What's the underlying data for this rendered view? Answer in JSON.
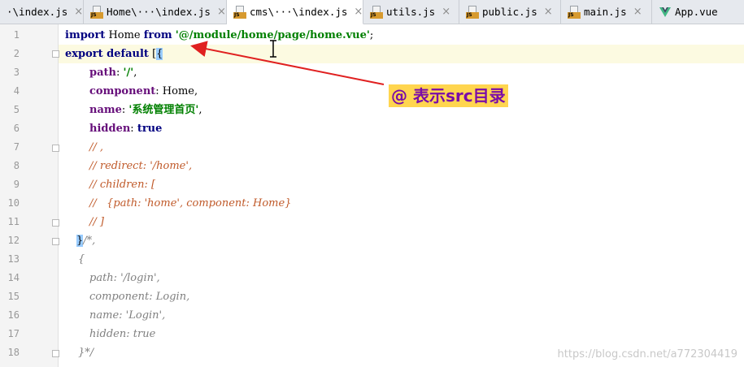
{
  "tabs": [
    {
      "label": "·\\index.js",
      "type": "js",
      "active": false
    },
    {
      "label": "Home\\···\\index.js",
      "type": "js",
      "active": false
    },
    {
      "label": "cms\\···\\index.js",
      "type": "js",
      "active": true
    },
    {
      "label": "utils.js",
      "type": "js",
      "active": false
    },
    {
      "label": "public.js",
      "type": "js",
      "active": false
    },
    {
      "label": "main.js",
      "type": "js",
      "active": false
    },
    {
      "label": "App.vue",
      "type": "vue",
      "active": false
    }
  ],
  "tab_close_glyph": "×",
  "icons": {
    "js_badge": "JS",
    "js_file": "js-file-icon",
    "vue_file": "vue-logo-icon"
  },
  "line_numbers": [
    "1",
    "2",
    "3",
    "4",
    "5",
    "6",
    "7",
    "8",
    "9",
    "10",
    "11",
    "12",
    "13",
    "14",
    "15",
    "16",
    "17",
    "18"
  ],
  "code": {
    "l1": {
      "kw1": "import",
      "t1": " Home ",
      "kw2": "from",
      "t2": " ",
      "str": "'@/module/home/page/home.vue'",
      "t3": ";"
    },
    "l2": {
      "kw": "export default",
      "t1": " [",
      "brace": "{"
    },
    "l3": {
      "prop": "path",
      "t1": ": ",
      "str": "'/'",
      "t2": ","
    },
    "l4": {
      "prop": "component",
      "t1": ": Home,"
    },
    "l5": {
      "prop": "name",
      "t1": ": ",
      "str": "'系统管理首页'",
      "t2": ","
    },
    "l6": {
      "prop": "hidden",
      "t1": ": ",
      "kw": "true"
    },
    "l7": {
      "cmt": "// ,"
    },
    "l8": {
      "cmt": "// redirect: '/home',"
    },
    "l9": {
      "cmt": "// children: ["
    },
    "l10": {
      "cmt": "//   {path: 'home', component: Home}"
    },
    "l11": {
      "cmt": "// ]"
    },
    "l12": {
      "brace": "}",
      "cmt": "/*,"
    },
    "l13": {
      "gcmt": "{"
    },
    "l14": {
      "gcmt": "path: '/login',"
    },
    "l15": {
      "gcmt": "component: Login,"
    },
    "l16": {
      "gcmt": "name: 'Login',"
    },
    "l17": {
      "gcmt": "hidden: true"
    },
    "l18": {
      "gcmt": "}*/"
    }
  },
  "annotation": "@ 表示src目录",
  "watermark": "https://blog.csdn.net/a772304419",
  "colors": {
    "annotation_bg": "#ffd54f",
    "annotation_text": "#7a0ca8",
    "arrow": "#e02020",
    "keyword": "#000080",
    "string": "#008000",
    "property": "#660e7a",
    "comment": "#c05a2a"
  }
}
